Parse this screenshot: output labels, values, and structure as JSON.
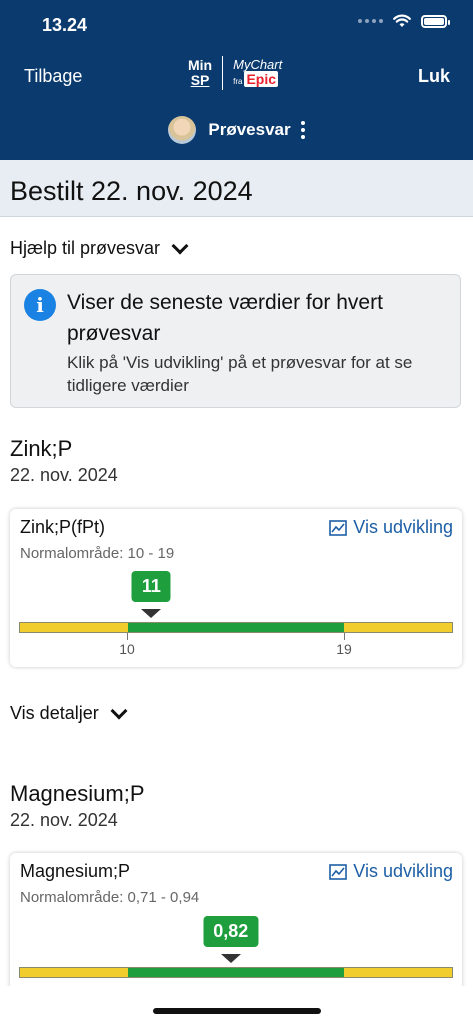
{
  "status_bar": {
    "time": "13.24"
  },
  "header": {
    "back_label": "Tilbage",
    "close_label": "Luk",
    "logo_min": "Min",
    "logo_sp": "SP",
    "logo_mychart": "MyChart",
    "logo_fra": "fra",
    "logo_epic": "Epic",
    "patient_name": "Prøvesvar"
  },
  "ordered": {
    "title": "Bestilt 22. nov. 2024"
  },
  "help": {
    "label": "Hjælp til prøvesvar"
  },
  "info": {
    "title": "Viser de seneste værdier for hvert prøvesvar",
    "text": "Klik på 'Vis udvikling' på et prøvesvar for at se tidligere værdier"
  },
  "results": [
    {
      "title": "Zink;P",
      "date": "22. nov. 2024",
      "component": "Zink;P(fPt)",
      "range": "Normalområde: 10 - 19",
      "trend_label": "Vis udvikling",
      "value": "11",
      "low_label": "10",
      "high_label": "19",
      "value_fraction": 0.305
    },
    {
      "title": "Magnesium;P",
      "date": "22. nov. 2024",
      "component": "Magnesium;P",
      "range": "Normalområde: 0,71 - 0,94",
      "trend_label": "Vis udvikling",
      "value": "0,82",
      "value_fraction": 0.488
    }
  ],
  "details": {
    "label": "Vis detaljer"
  },
  "colors": {
    "header": "#0b3a6e",
    "normal": "#1f9e3e",
    "abnormal": "#f2cd2e",
    "link": "#1d5fa6"
  },
  "icons": [
    "wifi-icon",
    "battery-icon",
    "avatar",
    "more-icon",
    "chevron-down-icon",
    "info-icon",
    "trend-chart-icon"
  ]
}
